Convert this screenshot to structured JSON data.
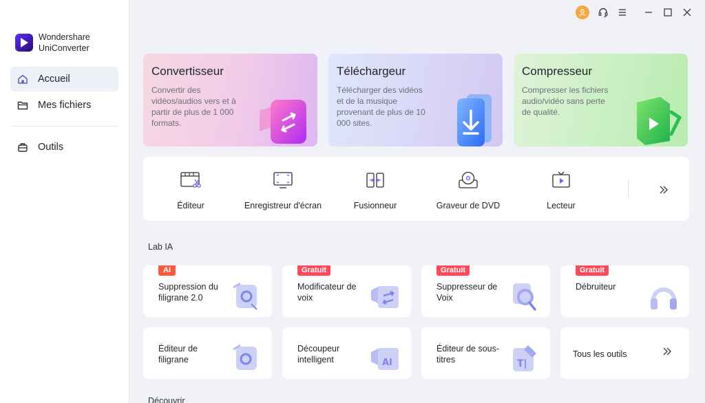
{
  "app": {
    "name_line1": "Wondershare",
    "name_line2": "UniConverter"
  },
  "sidebar": {
    "items": [
      {
        "label": "Accueil",
        "icon": "home-icon",
        "active": true
      },
      {
        "label": "Mes fichiers",
        "icon": "folder-icon",
        "active": false
      },
      {
        "label": "Outils",
        "icon": "toolbox-icon",
        "active": false
      }
    ]
  },
  "titlebar": {
    "icons": [
      "avatar-icon",
      "headset-icon",
      "menu-icon",
      "minimize-icon",
      "maximize-icon",
      "close-icon"
    ]
  },
  "features": [
    {
      "title": "Convertisseur",
      "desc": "Convertir des vidéos/audios vers et à partir de plus de 1 000 formats."
    },
    {
      "title": "Téléchargeur",
      "desc": "Télécharger des vidéos et de la musique provenant de plus de 10 000 sites."
    },
    {
      "title": "Compresseur",
      "desc": "Compresser les fichiers audio/vidéo sans perte de qualité."
    }
  ],
  "tools": [
    {
      "label": "Éditeur",
      "icon": "editor-icon"
    },
    {
      "label": "Enregistreur d'écran",
      "icon": "screen-recorder-icon"
    },
    {
      "label": "Fusionneur",
      "icon": "merger-icon"
    },
    {
      "label": "Graveur de DVD",
      "icon": "dvd-burner-icon"
    },
    {
      "label": "Lecteur",
      "icon": "player-icon"
    }
  ],
  "lab": {
    "title": "Lab IA",
    "cards": [
      {
        "label": "Suppression du filigrane 2.0",
        "badge": "AI"
      },
      {
        "label": "Modificateur de voix",
        "badge": "Gratuit"
      },
      {
        "label": "Suppresseur de Voix",
        "badge": "Gratuit"
      },
      {
        "label": "Débruiteur",
        "badge": "Gratuit"
      },
      {
        "label": "Éditeur de filigrane",
        "badge": ""
      },
      {
        "label": "Découpeur intelligent",
        "badge": ""
      },
      {
        "label": "Éditeur de sous-titres",
        "badge": ""
      },
      {
        "label": "Tous les outils",
        "badge": ""
      }
    ]
  },
  "discover": {
    "title": "Découvrir"
  },
  "colors": {
    "accent": "#7b5cff",
    "badge_ai": "#ff5a3c",
    "badge_free": "#ff4a5a",
    "avatar": "#f5a742"
  }
}
